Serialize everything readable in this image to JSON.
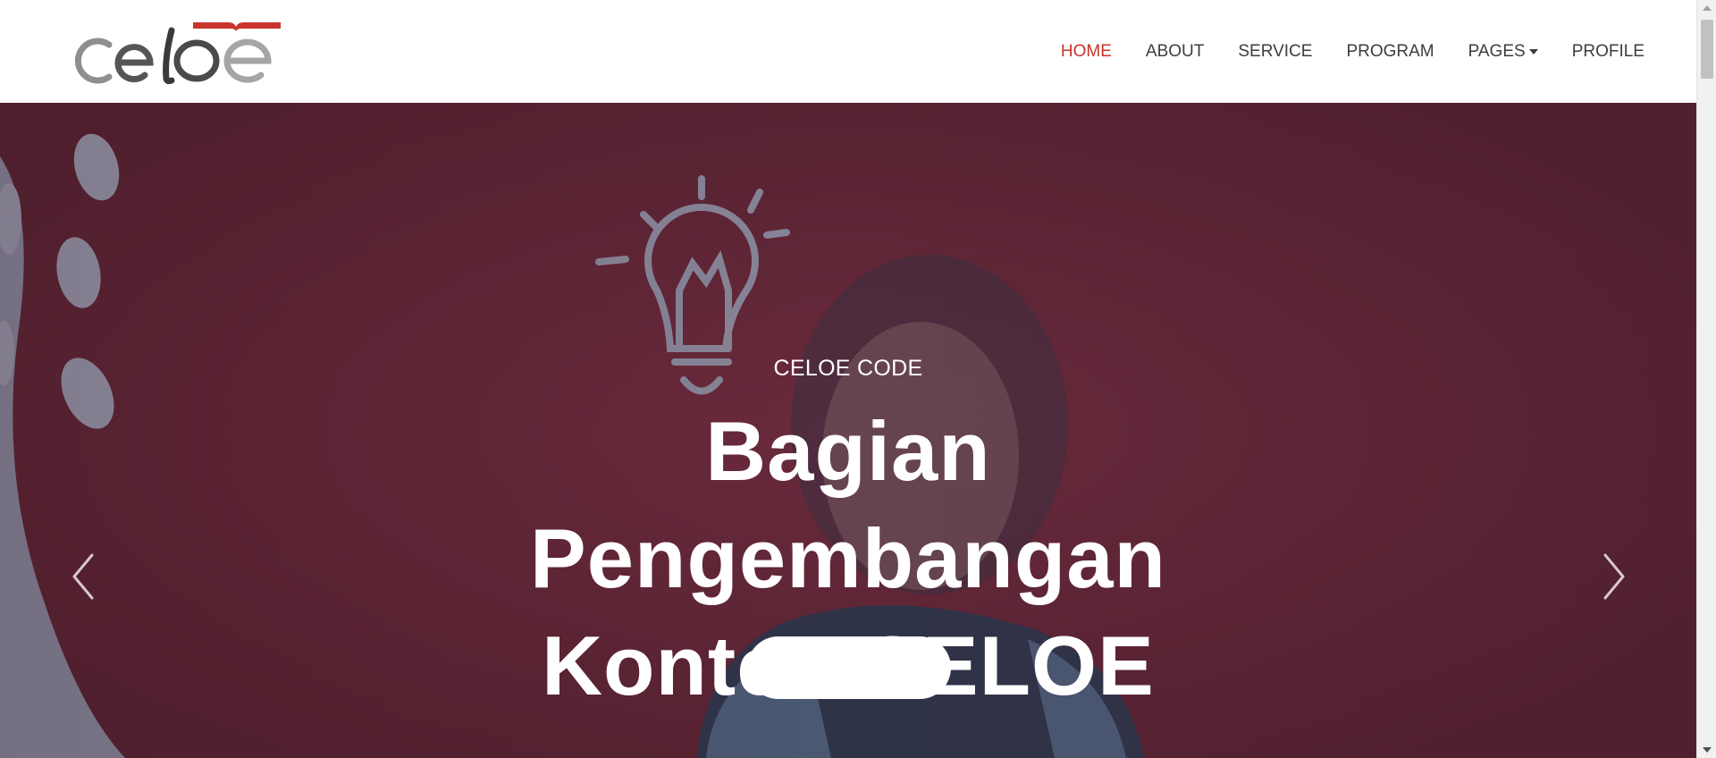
{
  "navbar": {
    "logo_alt": "celoe",
    "items": [
      {
        "label": "HOME",
        "active": true
      },
      {
        "label": "ABOUT",
        "active": false
      },
      {
        "label": "SERVICE",
        "active": false
      },
      {
        "label": "PROGRAM",
        "active": false
      },
      {
        "label": "PAGES",
        "active": false,
        "dropdown": true
      },
      {
        "label": "PROFILE",
        "active": false
      }
    ]
  },
  "hero": {
    "subtitle": "CELOE CODE",
    "title_lines": [
      "Bagian",
      "Pengembangan",
      "Konten CELOE"
    ],
    "prev_icon": "chevron-left-icon",
    "next_icon": "chevron-right-icon"
  },
  "colors": {
    "accent": "#c9342c",
    "hero_bg": "#5c2636",
    "nav_text": "#3d3d3d"
  }
}
